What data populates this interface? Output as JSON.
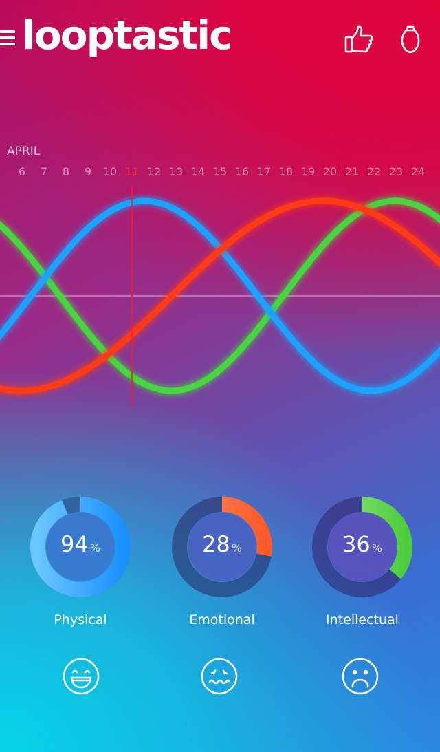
{
  "app": {
    "logo": "looptastic",
    "icons": [
      "menu-icon",
      "thumbs-up-icon",
      "lightbulb-icon"
    ]
  },
  "timeline": {
    "month": "APRIL",
    "days": [
      "6",
      "7",
      "8",
      "9",
      "10",
      "11",
      "12",
      "13",
      "14",
      "15",
      "16",
      "17",
      "18",
      "19",
      "20",
      "21",
      "22",
      "23",
      "24"
    ],
    "today": "11"
  },
  "colors": {
    "physical": "#1aa2ff",
    "emotional": "#ff3a12",
    "intellectual": "#46d63f",
    "today_marker": "#ff1a1a"
  },
  "gauges": [
    {
      "name": "physical",
      "value": "94",
      "unit": "%",
      "percent": 94,
      "label": "Physical",
      "mood_icon": "happy-face-icon"
    },
    {
      "name": "emotional",
      "value": "28",
      "unit": "%",
      "percent": 28,
      "label": "Emotional",
      "mood_icon": "worried-face-icon"
    },
    {
      "name": "intellectual",
      "value": "36",
      "unit": "%",
      "percent": 36,
      "label": "Intellectual",
      "mood_icon": "sad-face-icon"
    }
  ]
}
